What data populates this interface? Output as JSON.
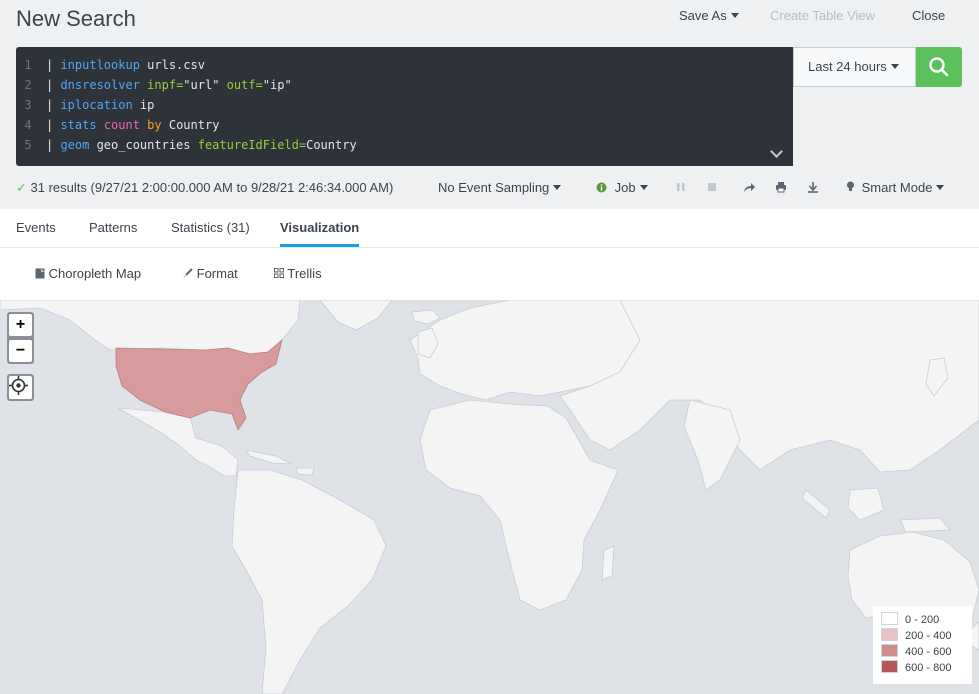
{
  "header": {
    "title": "New Search",
    "save_as": "Save As",
    "create_table_view": "Create Table View",
    "close": "Close"
  },
  "search": {
    "lines": [
      {
        "num": "1",
        "tokens": [
          {
            "t": "| ",
            "c": ""
          },
          {
            "t": "inputlookup",
            "c": "k1"
          },
          {
            "t": " urls.csv",
            "c": ""
          }
        ]
      },
      {
        "num": "2",
        "tokens": [
          {
            "t": "| ",
            "c": ""
          },
          {
            "t": "dnsresolver",
            "c": "k1"
          },
          {
            "t": " ",
            "c": ""
          },
          {
            "t": "inpf=",
            "c": "k4"
          },
          {
            "t": "\"url\" ",
            "c": ""
          },
          {
            "t": "outf=",
            "c": "k4"
          },
          {
            "t": "\"ip\"",
            "c": ""
          }
        ]
      },
      {
        "num": "3",
        "tokens": [
          {
            "t": "| ",
            "c": ""
          },
          {
            "t": "iplocation",
            "c": "k1"
          },
          {
            "t": " ip",
            "c": ""
          }
        ]
      },
      {
        "num": "4",
        "tokens": [
          {
            "t": "| ",
            "c": ""
          },
          {
            "t": "stats",
            "c": "k1"
          },
          {
            "t": " ",
            "c": ""
          },
          {
            "t": "count",
            "c": "k2"
          },
          {
            "t": " ",
            "c": ""
          },
          {
            "t": "by",
            "c": "k3"
          },
          {
            "t": " Country",
            "c": ""
          }
        ]
      },
      {
        "num": "5",
        "tokens": [
          {
            "t": "| ",
            "c": ""
          },
          {
            "t": "geom",
            "c": "k1"
          },
          {
            "t": " geo_countries ",
            "c": ""
          },
          {
            "t": "featureIdField=",
            "c": "k4"
          },
          {
            "t": "Country",
            "c": ""
          }
        ]
      }
    ],
    "time_range": "Last 24 hours"
  },
  "status": {
    "results": "31 results (9/27/21 2:00:00.000 AM to 9/28/21 2:46:34.000 AM)",
    "sampling": "No Event Sampling",
    "job": "Job",
    "mode": "Smart Mode"
  },
  "tabs": [
    {
      "label": "Events"
    },
    {
      "label": "Patterns"
    },
    {
      "label": "Statistics (31)"
    },
    {
      "label": "Visualization"
    }
  ],
  "viz_toolbar": {
    "type": "Choropleth Map",
    "format": "Format",
    "trellis": "Trellis"
  },
  "legend": [
    {
      "label": "0 - 200",
      "color": "#ffffff"
    },
    {
      "label": "200 - 400",
      "color": "#e7c3c3"
    },
    {
      "label": "400 - 600",
      "color": "#cf8d8d"
    },
    {
      "label": "600 - 800",
      "color": "#b55757"
    }
  ],
  "colors": {
    "accent": "#1a9fd8",
    "search_button": "#5cc05c",
    "highlight_country": "#d79a9d",
    "land": "#f4f4f4",
    "water": "#dfe3e7"
  }
}
